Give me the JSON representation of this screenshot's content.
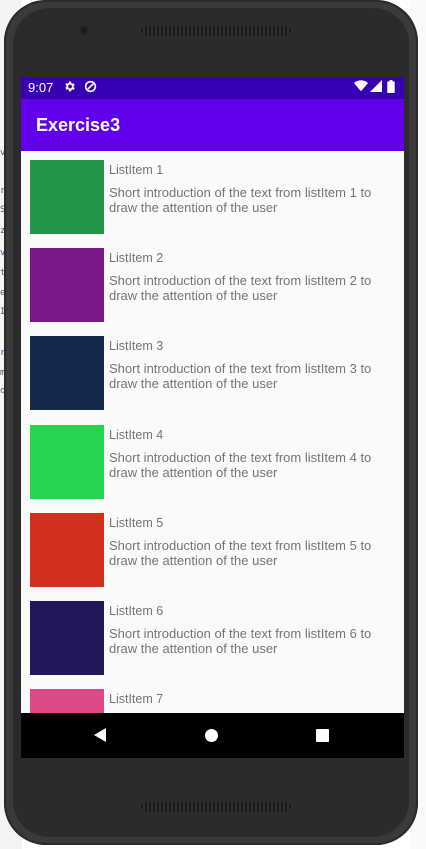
{
  "status_bar": {
    "time": "9:07",
    "icons": [
      "gear-icon",
      "data-saver-icon",
      "wifi-icon",
      "signal-icon",
      "battery-icon"
    ]
  },
  "app_bar": {
    "title": "Exercise3"
  },
  "list": {
    "items": [
      {
        "title": "ListItem 1",
        "description": "Short introduction of the text from listItem 1 to draw the attention of the user",
        "color": "#23964a"
      },
      {
        "title": "ListItem 2",
        "description": "Short introduction of the text from listItem 2 to draw the attention of the user",
        "color": "#7b1789"
      },
      {
        "title": "ListItem 3",
        "description": "Short introduction of the text from listItem 3 to draw the attention of the user",
        "color": "#13284b"
      },
      {
        "title": "ListItem 4",
        "description": "Short introduction of the text from listItem 4 to draw the attention of the user",
        "color": "#27d44f"
      },
      {
        "title": "ListItem 5",
        "description": "Short introduction of the text from listItem 5 to draw the attention of the user",
        "color": "#d1301c"
      },
      {
        "title": "ListItem 6",
        "description": "Short introduction of the text from listItem 6 to draw the attention of the user",
        "color": "#23175a"
      },
      {
        "title": "ListItem 7",
        "description": "",
        "color": "#dc4a8a"
      }
    ]
  },
  "nav_bar": {
    "icons": [
      "back-icon",
      "home-icon",
      "recents-icon"
    ]
  },
  "colors": {
    "status_bar": "#3700b3",
    "app_bar": "#6200ee",
    "list_background": "#fafafa",
    "text": "#757575"
  }
}
